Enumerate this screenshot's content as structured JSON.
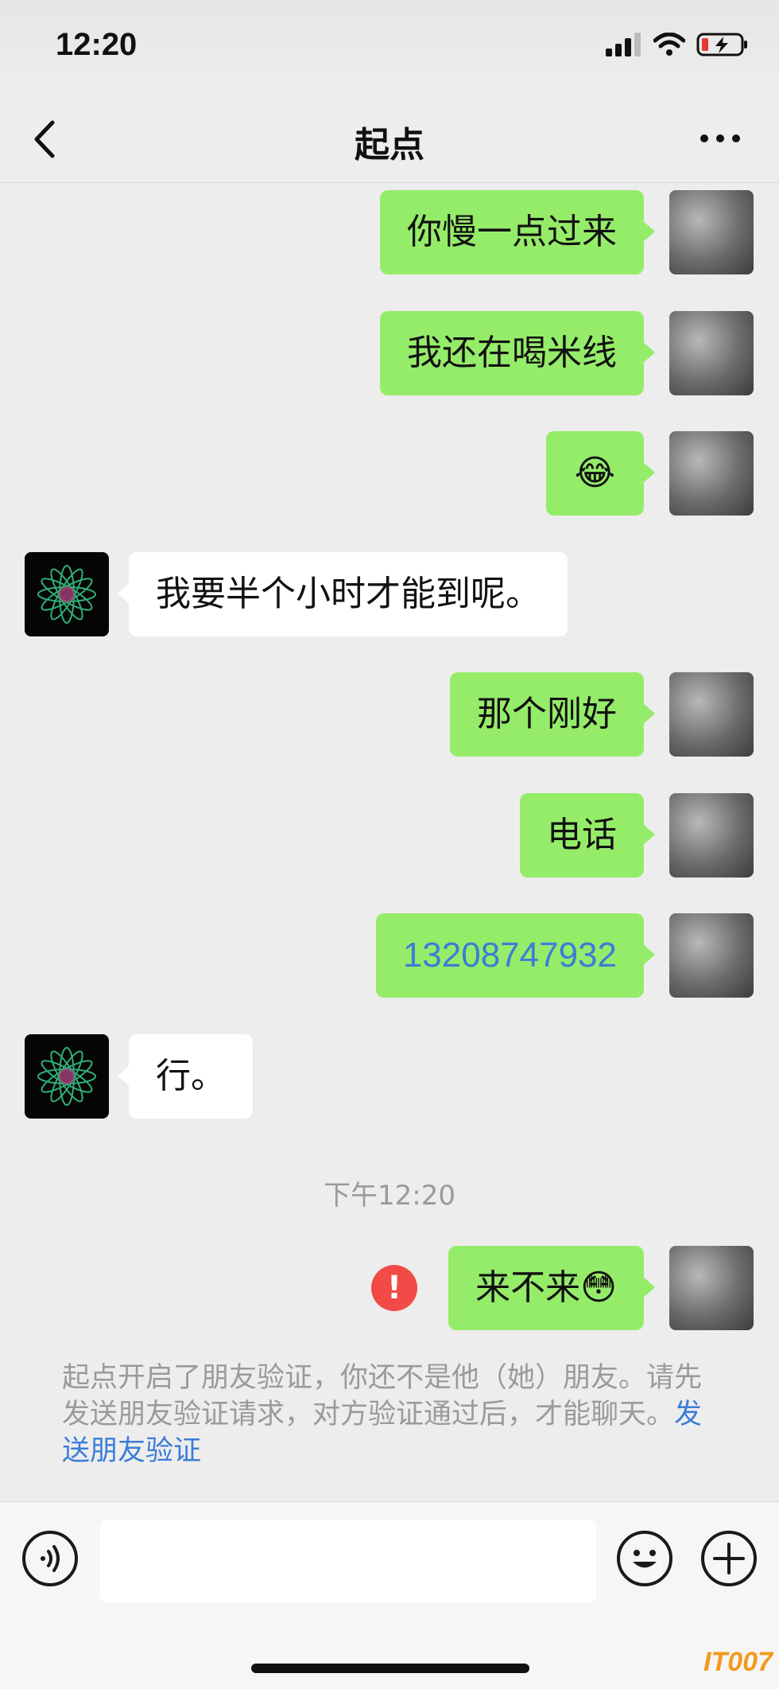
{
  "status_bar": {
    "time": "12:20"
  },
  "nav": {
    "title": "起点"
  },
  "messages": [
    {
      "side": "self",
      "text": "你慢一点过来"
    },
    {
      "side": "self",
      "text": "我还在喝米线"
    },
    {
      "side": "self",
      "text": "😂"
    },
    {
      "side": "other",
      "text": "我要半个小时才能到呢。"
    },
    {
      "side": "self",
      "text": "那个刚好"
    },
    {
      "side": "self",
      "text": "电话"
    },
    {
      "side": "self",
      "text": "13208747932"
    },
    {
      "side": "other",
      "text": "行。"
    },
    {
      "side": "self",
      "text": "来不来😳",
      "status": "!"
    }
  ],
  "timestamp": "下午12:20",
  "system_notice": {
    "text": "起点开启了朋友验证，你还不是他（她）朋友。请先发送朋友验证请求，对方验证通过后，才能聊天。",
    "link": "发送朋友验证"
  },
  "input_bar": {
    "value": ""
  },
  "icons": {
    "back": "chevron-left-icon",
    "more": "more-dots-icon",
    "voice": "voice-icon",
    "emoji": "emoji-icon",
    "plus": "plus-icon",
    "error": "error-icon"
  },
  "colors": {
    "self_bubble": "#95ec69",
    "other_bubble": "#ffffff",
    "link": "#3b7dd8",
    "error": "#f24a47",
    "background": "#ededed"
  },
  "watermark": "IT007"
}
